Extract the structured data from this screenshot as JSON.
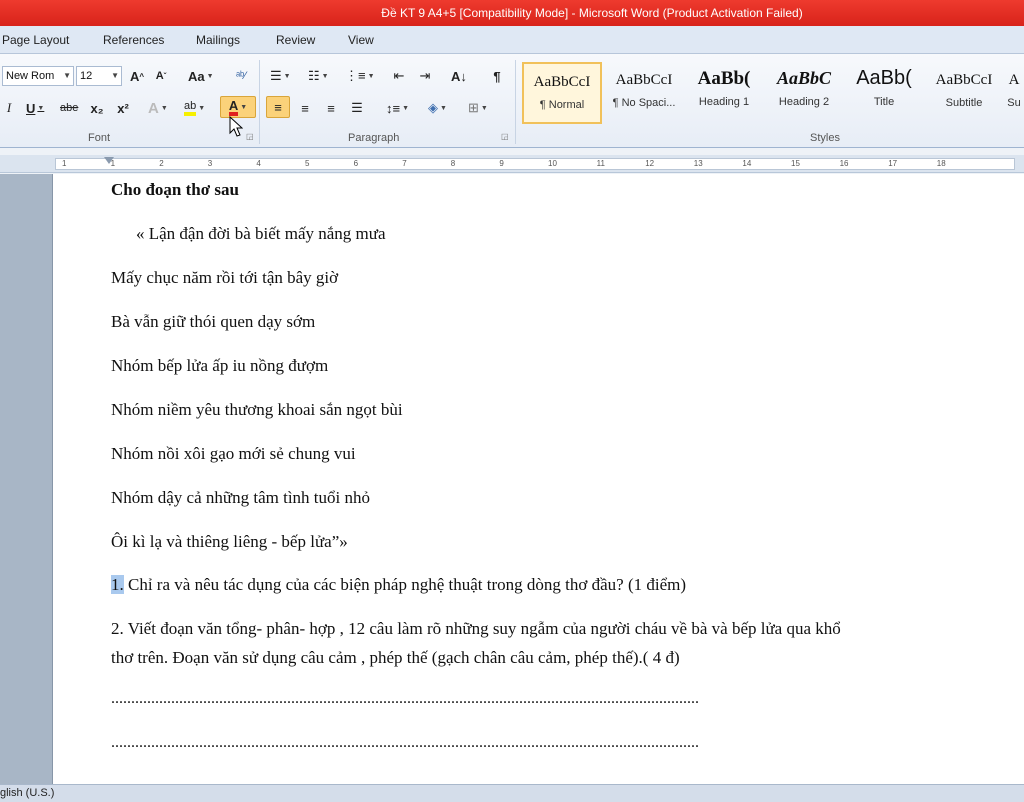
{
  "window": {
    "title": "Đề KT 9 A4+5 [Compatibility Mode]  -  Microsoft Word (Product Activation Failed)"
  },
  "tabs": [
    "Page Layout",
    "References",
    "Mailings",
    "Review",
    "View"
  ],
  "font": {
    "name": "New Rom",
    "size": "12",
    "group_label": "Font",
    "grow": "A",
    "shrink": "A",
    "case": "Aa",
    "underline": "U",
    "strike": "abe",
    "sub": "x₂",
    "sup": "x²",
    "italic": "I",
    "highlight": "ab",
    "color": "A"
  },
  "paragraph": {
    "group_label": "Paragraph",
    "pilcrow": "¶"
  },
  "styles": {
    "group_label": "Styles",
    "items": [
      {
        "preview": "AaBbCcI",
        "name": "¶ Normal"
      },
      {
        "preview": "AaBbCcI",
        "name": "¶ No Spaci..."
      },
      {
        "preview": "AaBb(",
        "name": "Heading 1"
      },
      {
        "preview": "AaBbC",
        "name": "Heading 2"
      },
      {
        "preview": "AaBb(",
        "name": "Title"
      },
      {
        "preview": "AaBbCcI",
        "name": "Subtitle"
      },
      {
        "preview": "A",
        "name": "Su"
      }
    ]
  },
  "ruler": {
    "numbers": [
      "1",
      "1",
      "2",
      "3",
      "4",
      "5",
      "6",
      "7",
      "8",
      "9",
      "10",
      "11",
      "12",
      "13",
      "14",
      "15",
      "16",
      "17",
      "18"
    ]
  },
  "document": {
    "heading": "Cho đoạn thơ sau",
    "poem": [
      "« Lận đận đời bà biết mấy nắng mưa",
      "Mấy chục năm rồi tới tận bây giờ",
      "Bà vẫn giữ thói quen dạy sớm",
      "Nhóm bếp lửa ấp iu nồng đượm",
      "Nhóm niềm yêu thương khoai sắn ngọt bùi",
      "Nhóm nồi xôi gạo mới sẻ chung vui",
      "Nhóm dậy cả những tâm tình tuổi nhỏ",
      "Ôi kì lạ và thiêng liêng - bếp lửa”»"
    ],
    "q1_num": "1.",
    "q1_text": " Chỉ ra và nêu tác dụng của các biện pháp nghệ thuật trong dòng thơ đầu? (1 điểm)",
    "q2_line1": "2. Viết đoạn văn tổng- phân- hợp , 12 câu làm rõ những suy ngẫm của người cháu về bà và bếp lửa qua khổ",
    "q2_line2": "thơ trên. Đoạn văn sử dụng câu cảm , phép thế (gạch chân câu  cảm, phép thế).( 4 đ)",
    "dots": "..................................................................................................................................................."
  },
  "status": {
    "language": "glish (U.S.)"
  },
  "colors": {
    "title_bar": "#d8231a",
    "font_color": "#e02020",
    "highlight": "#f6f000",
    "selection": "#a9c9ee"
  }
}
